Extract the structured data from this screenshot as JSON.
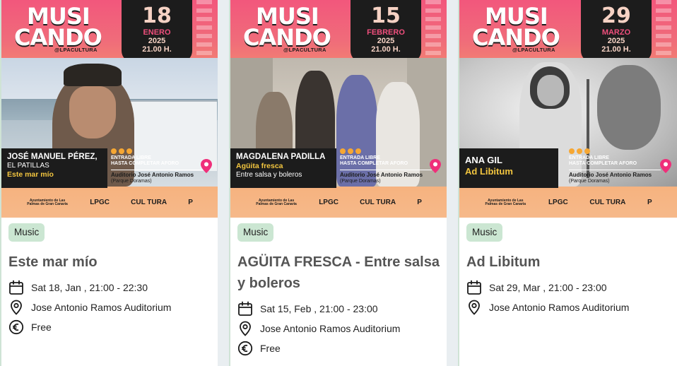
{
  "colors": {
    "tag_bg": "#cbe6d2",
    "title": "#555555",
    "poster_pink": "#f2577c",
    "poster_orange": "#f6ab73",
    "poster_dark": "#1c1c1c",
    "date_accent": "#ef4f7c"
  },
  "icons": {
    "date": "calendar-icon",
    "place": "location-pin-icon",
    "price": "euro-icon"
  },
  "events": [
    {
      "poster": {
        "logo_line1": "MUSI",
        "logo_line2": "CANDO",
        "handle": "@LPACULTURA",
        "day": "18",
        "month": "ENERO",
        "year": "2025",
        "hour": "21.00 H.",
        "name_line1": "JOSÉ MANUEL PÉREZ,",
        "name_line2": "EL PATILLAS",
        "name_line3": "Este mar mío",
        "entry_line1": "ENTRADA LIBRE",
        "entry_line2": "HASTA COMPLETAR AFORO",
        "venue_line1": "Auditorio José Antonio Ramos",
        "venue_line2": "(Parque Doramas)",
        "logos": [
          "Ayuntamiento de Las Palmas de Gran Canaria",
          "LPGC",
          "CUL TURA",
          "P"
        ]
      },
      "tag": "Music",
      "title": "Este mar mío",
      "date": "Sat 18, Jan , 21:00 - 22:30",
      "place": "Jose Antonio Ramos Auditorium",
      "price": "Free"
    },
    {
      "poster": {
        "logo_line1": "MUSI",
        "logo_line2": "CANDO",
        "handle": "@LPACULTURA",
        "day": "15",
        "month": "FEBRERO",
        "year": "2025",
        "hour": "21.00 H.",
        "name_line1": "MAGDALENA PADILLA",
        "name_line2": "Agüita fresca",
        "name_line3": "Entre salsa y boleros",
        "entry_line1": "ENTRADA LIBRE",
        "entry_line2": "HASTA COMPLETAR AFORO",
        "venue_line1": "Auditorio José Antonio Ramos",
        "venue_line2": "(Parque Doramas)",
        "logos": [
          "Ayuntamiento de Las Palmas de Gran Canaria",
          "LPGC",
          "CUL TURA",
          "P"
        ]
      },
      "tag": "Music",
      "title": "AGÜITA FRESCA - Entre salsa y boleros",
      "date": "Sat 15, Feb , 21:00 - 23:00",
      "place": "Jose Antonio Ramos Auditorium",
      "price": "Free"
    },
    {
      "poster": {
        "logo_line1": "MUSI",
        "logo_line2": "CANDO",
        "handle": "@LPACULTURA",
        "day": "29",
        "month": "MARZO",
        "year": "2025",
        "hour": "21.00 H.",
        "name_line1": "ANA GIL",
        "name_line2": "Ad Libitum",
        "entry_line1": "ENTRADA LIBRE",
        "entry_line2": "HASTA COMPLETAR AFORO",
        "venue_line1": "Auditorio José Antonio Ramos",
        "venue_line2": "(Parque Doramas)",
        "logos": [
          "Ayuntamiento de Las Palmas de Gran Canaria",
          "LPGC",
          "CUL TURA",
          "P"
        ]
      },
      "tag": "Music",
      "title": "Ad Libitum",
      "date": "Sat 29, Mar , 21:00 - 23:00",
      "place": "Jose Antonio Ramos Auditorium"
    }
  ]
}
